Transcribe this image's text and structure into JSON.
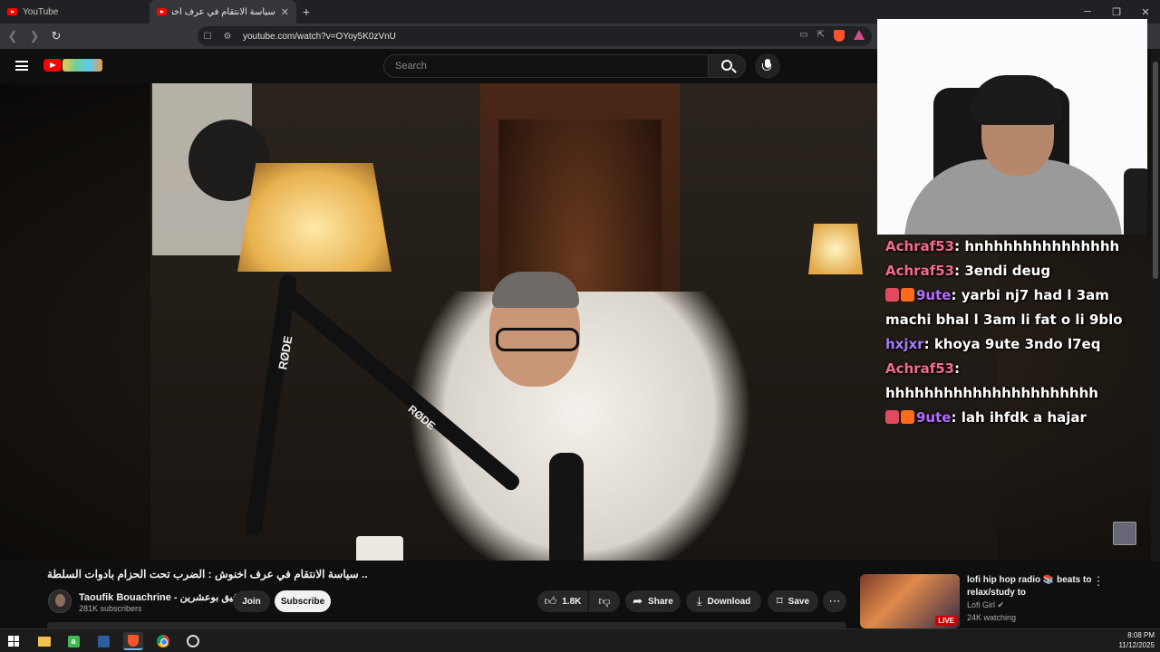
{
  "browser": {
    "tabs": [
      {
        "title": "YouTube"
      },
      {
        "title": "سياسة الانتقام في عرف اخنوش : ا"
      }
    ],
    "new_tab": "+",
    "url": "youtube.com/watch?v=OYoy5K0zVnU"
  },
  "youtube": {
    "search_placeholder": "Search"
  },
  "video_overlay": {
    "mic_brand_1": "RØDE",
    "mic_brand_2": "RØDE"
  },
  "chat": {
    "messages": [
      {
        "user": "Achraf53",
        "text": "hnhhhhhhhhhhhhhh",
        "color": "#f26b8a",
        "badges": []
      },
      {
        "user": "Achraf53",
        "text": "3endi deug",
        "color": "#f26b8a",
        "badges": []
      },
      {
        "user": "9ute",
        "text": "yarbi nj7 had l 3am machi bhal l 3am li fat o li 9blo",
        "color": "#b46cff",
        "badges": [
          "rocket",
          "og"
        ]
      },
      {
        "user": "hxjxr",
        "text": "khoya 9ute 3ndo l7eq",
        "color": "#a47dff",
        "badges": []
      },
      {
        "user": "Achraf53",
        "text": "hhhhhhhhhhhhhhhhhhhhhh",
        "color": "#f26b8a",
        "badges": []
      },
      {
        "user": "9ute",
        "text": "lah ihfdk a hajar",
        "color": "#b46cff",
        "badges": [
          "rocket",
          "og"
        ]
      }
    ]
  },
  "video_info": {
    "title": ".. سياسة الانتقام في عرف اخنوش : الضرب تحت الحزام بادوات السلطة",
    "channel_name": "Taoufik Bouachrine - توفيق بوعشرين",
    "subscribers": "281K subscribers",
    "join_label": "Join",
    "subscribe_label": "Subscribe",
    "likes": "1.8K",
    "share_label": "Share",
    "download_label": "Download",
    "save_label": "Save"
  },
  "recommended": {
    "title": "lofi hip hop radio 📚 beats to relax/study to",
    "channel": "Lofi Girl",
    "watching": "24K watching",
    "live_label": "LIVE"
  },
  "taskbar": {
    "time": "8:08 PM",
    "date": "11/12/2025"
  },
  "colors": {
    "youtube_red": "#ff0000",
    "chat_pink": "#f26b8a",
    "chat_purple": "#b46cff",
    "chat_violet": "#a47dff"
  }
}
